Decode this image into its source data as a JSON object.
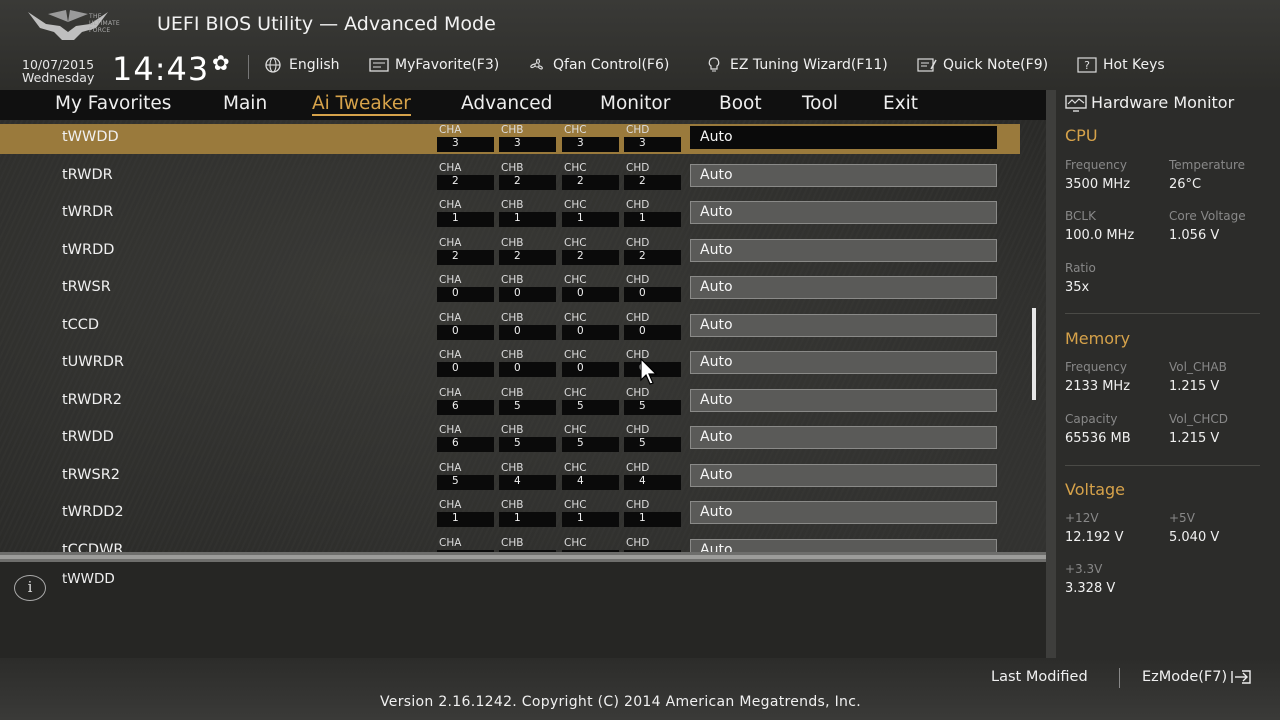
{
  "header": {
    "app_title": "UEFI BIOS Utility — Advanced Mode",
    "logo_text": [
      "THE",
      "ULTIMATE",
      "FORCE"
    ],
    "date": "10/07/2015",
    "weekday": "Wednesday",
    "time": "14:43",
    "toolbar": [
      {
        "label": "English",
        "icon": "globe-icon"
      },
      {
        "label": "MyFavorite(F3)",
        "icon": "favorite-icon"
      },
      {
        "label": "Qfan Control(F6)",
        "icon": "fan-icon"
      },
      {
        "label": "EZ Tuning Wizard(F11)",
        "icon": "bulb-icon"
      },
      {
        "label": "Quick Note(F9)",
        "icon": "note-icon"
      },
      {
        "label": "Hot Keys",
        "icon": "hotkey-icon"
      }
    ]
  },
  "menu": {
    "items": [
      "My Favorites",
      "Main",
      "Ai Tweaker",
      "Advanced",
      "Monitor",
      "Boot",
      "Tool",
      "Exit"
    ],
    "active": "Ai Tweaker"
  },
  "settings": [
    {
      "name": "tWWDD",
      "cha": "3",
      "chb": "3",
      "chc": "3",
      "chd": "3",
      "value": "Auto"
    },
    {
      "name": "tRWDR",
      "cha": "2",
      "chb": "2",
      "chc": "2",
      "chd": "2",
      "value": "Auto"
    },
    {
      "name": "tWRDR",
      "cha": "1",
      "chb": "1",
      "chc": "1",
      "chd": "1",
      "value": "Auto"
    },
    {
      "name": "tWRDD",
      "cha": "2",
      "chb": "2",
      "chc": "2",
      "chd": "2",
      "value": "Auto"
    },
    {
      "name": "tRWSR",
      "cha": "0",
      "chb": "0",
      "chc": "0",
      "chd": "0",
      "value": "Auto"
    },
    {
      "name": "tCCD",
      "cha": "0",
      "chb": "0",
      "chc": "0",
      "chd": "0",
      "value": "Auto"
    },
    {
      "name": "tUWRDR",
      "cha": "0",
      "chb": "0",
      "chc": "0",
      "chd": "0",
      "value": "Auto"
    },
    {
      "name": "tRWDR2",
      "cha": "6",
      "chb": "5",
      "chc": "5",
      "chd": "5",
      "value": "Auto"
    },
    {
      "name": "tRWDD",
      "cha": "6",
      "chb": "5",
      "chc": "5",
      "chd": "5",
      "value": "Auto"
    },
    {
      "name": "tRWSR2",
      "cha": "5",
      "chb": "4",
      "chc": "4",
      "chd": "4",
      "value": "Auto"
    },
    {
      "name": "tWRDD2",
      "cha": "1",
      "chb": "1",
      "chc": "1",
      "chd": "1",
      "value": "Auto"
    },
    {
      "name": "tCCDWR",
      "cha": "",
      "chb": "",
      "chc": "",
      "chd": "",
      "value": "Auto"
    }
  ],
  "channel_labels": [
    "CHA",
    "CHB",
    "CHC",
    "CHD"
  ],
  "help": {
    "text": "tWWDD"
  },
  "hardware_monitor": {
    "title": "Hardware Monitor",
    "cpu": {
      "title": "CPU",
      "frequency_label": "Frequency",
      "frequency": "3500 MHz",
      "temperature_label": "Temperature",
      "temperature": "26°C",
      "bclk_label": "BCLK",
      "bclk": "100.0 MHz",
      "core_voltage_label": "Core Voltage",
      "core_voltage": "1.056 V",
      "ratio_label": "Ratio",
      "ratio": "35x"
    },
    "memory": {
      "title": "Memory",
      "frequency_label": "Frequency",
      "frequency": "2133 MHz",
      "vol_chab_label": "Vol_CHAB",
      "vol_chab": "1.215 V",
      "capacity_label": "Capacity",
      "capacity": "65536 MB",
      "vol_chcd_label": "Vol_CHCD",
      "vol_chcd": "1.215 V"
    },
    "voltage": {
      "title": "Voltage",
      "v12_label": "+12V",
      "v12": "12.192 V",
      "v5_label": "+5V",
      "v5": "5.040 V",
      "v33_label": "+3.3V",
      "v33": "3.328 V"
    }
  },
  "footer": {
    "last_modified": "Last Modified",
    "ezmode": "EzMode(F7)",
    "version": "Version 2.16.1242. Copyright (C) 2014 American Megatrends, Inc."
  },
  "colors": {
    "accent": "#d6a24a",
    "selected_row": "#9a7a3c",
    "value_box": "#5a5a58"
  }
}
